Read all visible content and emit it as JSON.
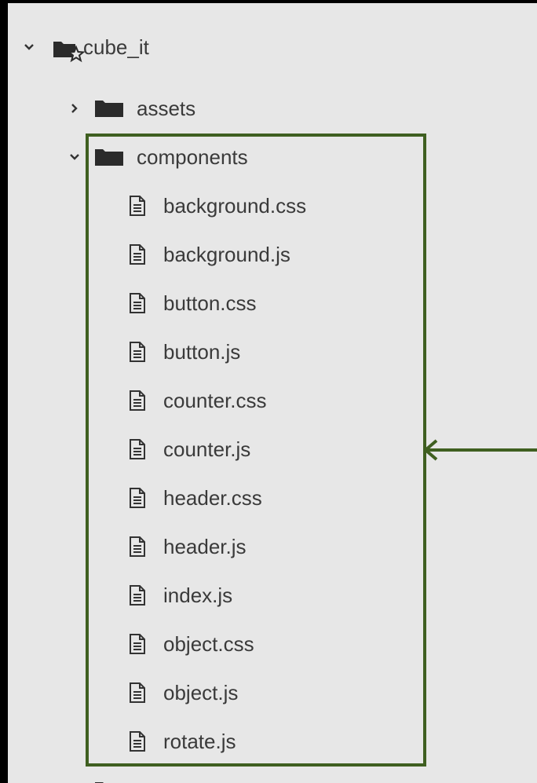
{
  "tree": {
    "root": {
      "label": "cube_it",
      "expanded": true,
      "icon": "folder-star-icon"
    },
    "assets": {
      "label": "assets",
      "expanded": false,
      "icon": "folder-icon"
    },
    "components": {
      "label": "components",
      "expanded": true,
      "icon": "folder-icon",
      "files": [
        "background.css",
        "background.js",
        "button.css",
        "button.js",
        "counter.css",
        "counter.js",
        "header.css",
        "header.js",
        "index.js",
        "object.css",
        "object.js",
        "rotate.js"
      ]
    }
  },
  "colors": {
    "panel_background": "#e7e7e7",
    "highlight_border": "#3f5f20",
    "text": "#3a3a3a"
  }
}
